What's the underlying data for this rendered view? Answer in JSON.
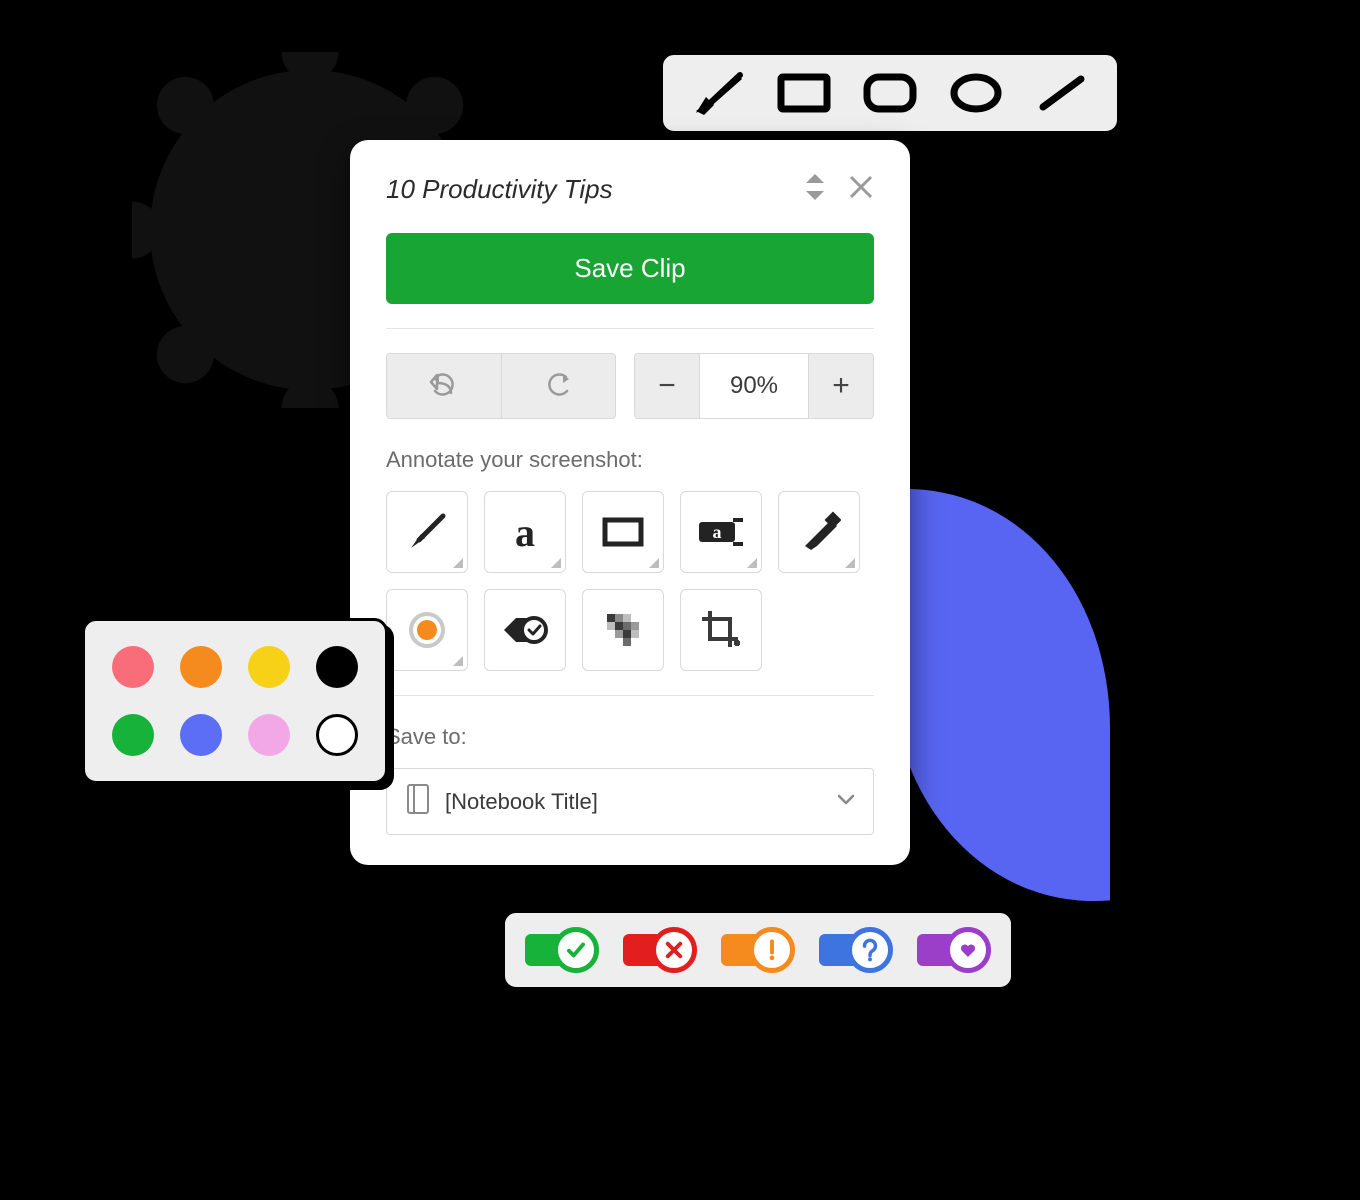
{
  "shape_toolbar": {
    "tools": [
      "arrow",
      "rectangle",
      "rounded-rectangle",
      "ellipse",
      "line"
    ]
  },
  "clipper": {
    "title": "10 Productivity Tips",
    "save_label": "Save Clip",
    "zoom_value": "90%",
    "annotate_label": "Annotate your screenshot:",
    "save_to_label": "Save to:",
    "notebook_placeholder": "[Notebook Title]",
    "tools_row1": [
      "arrow",
      "text",
      "rectangle",
      "stamp",
      "marker"
    ],
    "tools_row2": [
      "color",
      "tag",
      "pixelate",
      "crop"
    ]
  },
  "palette": {
    "colors": [
      "#f96d7a",
      "#f58a1f",
      "#f7d117",
      "#000000",
      "#17b23a",
      "#5b6ef5",
      "#f2a8e6",
      "hollow"
    ]
  },
  "stamps": [
    {
      "name": "check",
      "color": "#17b23a",
      "glyph": "check"
    },
    {
      "name": "cross",
      "color": "#e21e1e",
      "glyph": "cross"
    },
    {
      "name": "exclaim",
      "color": "#f58a1f",
      "glyph": "exclaim"
    },
    {
      "name": "question",
      "color": "#3e74e0",
      "glyph": "question"
    },
    {
      "name": "heart",
      "color": "#9b3fc9",
      "glyph": "heart"
    }
  ],
  "colors": {
    "accent_green": "#18a533"
  }
}
